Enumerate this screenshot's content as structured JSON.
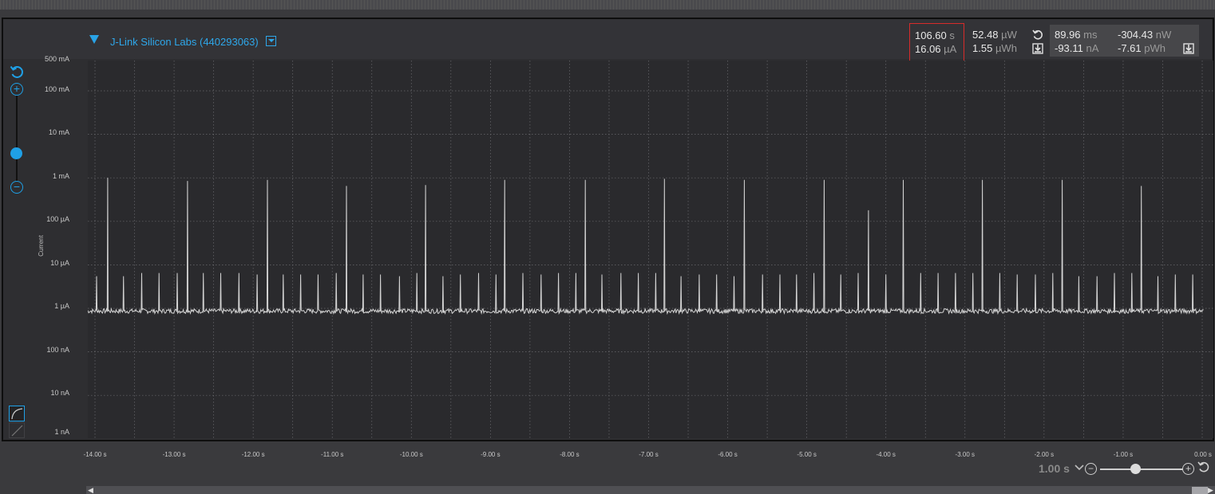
{
  "device": {
    "name": "J-Link Silicon Labs (440293063)"
  },
  "stats": {
    "time_value": "106.60",
    "time_unit": "s",
    "current_value": "16.06",
    "current_unit": "µA",
    "power_value": "52.48",
    "power_unit": "µW",
    "energy_value": "1.55",
    "energy_unit": "µWh",
    "delta_time_value": "89.96",
    "delta_time_unit": "ms",
    "delta_power_value": "-304.43",
    "delta_power_unit": "nW",
    "delta_current_value": "-93.11",
    "delta_current_unit": "nA",
    "delta_energy_value": "-7.61",
    "delta_energy_unit": "pWh"
  },
  "icons": {
    "device_expand": "triangle-down-icon",
    "device_dropdown": "dropdown-icon",
    "reset": "reset-icon",
    "download": "download-icon",
    "zoom_in": "zoom-in-icon",
    "zoom_out": "zoom-out-icon",
    "curve": "curve-icon",
    "linear": "linear-icon"
  },
  "colors": {
    "accent": "#1fa0e6",
    "trace": "#d4d4d4",
    "highlight_border": "#d72b2b",
    "plot_bg": "#2a2a2d"
  },
  "timebase": {
    "label": "1.00 s",
    "slider_fraction": 0.37
  },
  "chart_data": {
    "type": "line",
    "title": "",
    "ylabel": "Current",
    "xlabel": "",
    "y_scale": "log",
    "y_ticks": [
      "500 mA",
      "100 mA",
      "10 mA",
      "1 mA",
      "100 µA",
      "10 µA",
      "1 µA",
      "100 nA",
      "10 nA",
      "1 nA"
    ],
    "y_tick_values_amps": [
      0.5,
      0.1,
      0.01,
      0.001,
      0.0001,
      1e-05,
      1e-06,
      1e-07,
      1e-08,
      1e-09
    ],
    "x_ticks": [
      "-14.00 s",
      "-13.00 s",
      "-12.00 s",
      "-11.00 s",
      "-10.00 s",
      "-9.00 s",
      "-8.00 s",
      "-7.00 s",
      "-6.00 s",
      "-5.00 s",
      "-4.00 s",
      "-3.00 s",
      "-2.00 s",
      "-1.00 s",
      "0.00 s"
    ],
    "x_range_s": [
      -14.1,
      0.0
    ],
    "grid": true,
    "baseline_uA": 0.85,
    "series": [
      {
        "peaks": [
          {
            "t": -13.98,
            "uA": 5.5
          },
          {
            "t": -13.84,
            "uA": 1000
          },
          {
            "t": -13.64,
            "uA": 5.5
          },
          {
            "t": -13.41,
            "uA": 6.5
          },
          {
            "t": -13.19,
            "uA": 6.5
          },
          {
            "t": -12.96,
            "uA": 6.5
          },
          {
            "t": -12.83,
            "uA": 850
          },
          {
            "t": -12.63,
            "uA": 6.5
          },
          {
            "t": -12.41,
            "uA": 6.5
          },
          {
            "t": -12.18,
            "uA": 6.5
          },
          {
            "t": -11.95,
            "uA": 6.0
          },
          {
            "t": -11.82,
            "uA": 900
          },
          {
            "t": -11.62,
            "uA": 6.0
          },
          {
            "t": -11.4,
            "uA": 6.0
          },
          {
            "t": -11.18,
            "uA": 6.0
          },
          {
            "t": -10.95,
            "uA": 6.5
          },
          {
            "t": -10.82,
            "uA": 650
          },
          {
            "t": -10.61,
            "uA": 6.0
          },
          {
            "t": -10.39,
            "uA": 6.0
          },
          {
            "t": -10.15,
            "uA": 5.5
          },
          {
            "t": -9.93,
            "uA": 6.5
          },
          {
            "t": -9.82,
            "uA": 680
          },
          {
            "t": -9.6,
            "uA": 5.5
          },
          {
            "t": -9.38,
            "uA": 6.0
          },
          {
            "t": -9.15,
            "uA": 6.5
          },
          {
            "t": -8.93,
            "uA": 6.0
          },
          {
            "t": -8.82,
            "uA": 900
          },
          {
            "t": -8.59,
            "uA": 6.5
          },
          {
            "t": -8.36,
            "uA": 6.0
          },
          {
            "t": -8.14,
            "uA": 6.5
          },
          {
            "t": -7.92,
            "uA": 6.5
          },
          {
            "t": -7.8,
            "uA": 900
          },
          {
            "t": -7.59,
            "uA": 6.0
          },
          {
            "t": -7.35,
            "uA": 6.5
          },
          {
            "t": -7.13,
            "uA": 6.5
          },
          {
            "t": -6.91,
            "uA": 6.5
          },
          {
            "t": -6.8,
            "uA": 950
          },
          {
            "t": -6.59,
            "uA": 5.5
          },
          {
            "t": -6.36,
            "uA": 6.0
          },
          {
            "t": -6.14,
            "uA": 6.0
          },
          {
            "t": -5.92,
            "uA": 5.5
          },
          {
            "t": -5.79,
            "uA": 900
          },
          {
            "t": -5.56,
            "uA": 6.0
          },
          {
            "t": -5.34,
            "uA": 6.0
          },
          {
            "t": -5.13,
            "uA": 6.0
          },
          {
            "t": -4.91,
            "uA": 6.5
          },
          {
            "t": -4.78,
            "uA": 900
          },
          {
            "t": -4.57,
            "uA": 6.0
          },
          {
            "t": -4.35,
            "uA": 6.5
          },
          {
            "t": -4.22,
            "uA": 180
          },
          {
            "t": -4.0,
            "uA": 6.0
          },
          {
            "t": -3.78,
            "uA": 900
          },
          {
            "t": -3.56,
            "uA": 6.5
          },
          {
            "t": -3.34,
            "uA": 6.5
          },
          {
            "t": -3.12,
            "uA": 6.5
          },
          {
            "t": -2.9,
            "uA": 6.5
          },
          {
            "t": -2.78,
            "uA": 900
          },
          {
            "t": -2.56,
            "uA": 6.5
          },
          {
            "t": -2.34,
            "uA": 6.0
          },
          {
            "t": -2.11,
            "uA": 6.0
          },
          {
            "t": -1.89,
            "uA": 6.5
          },
          {
            "t": -1.77,
            "uA": 900
          },
          {
            "t": -1.56,
            "uA": 5.5
          },
          {
            "t": -1.33,
            "uA": 5.5
          },
          {
            "t": -1.11,
            "uA": 6.5
          },
          {
            "t": -0.89,
            "uA": 6.5
          },
          {
            "t": -0.77,
            "uA": 650
          },
          {
            "t": -0.56,
            "uA": 5.5
          },
          {
            "t": -0.34,
            "uA": 6.0
          },
          {
            "t": -0.12,
            "uA": 6.0
          }
        ]
      }
    ]
  }
}
